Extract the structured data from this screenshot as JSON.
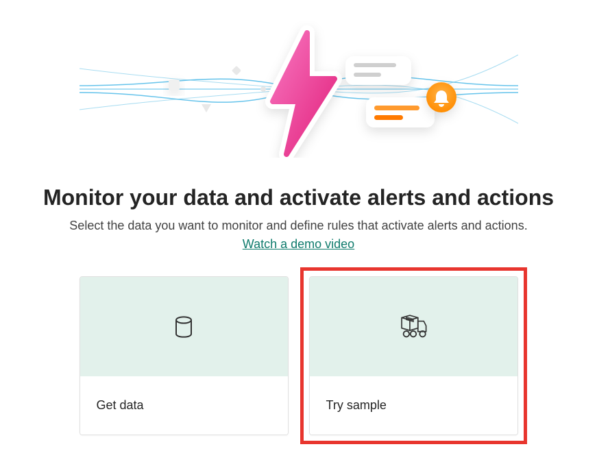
{
  "hero": {
    "heading": "Monitor your data and activate alerts and actions",
    "subtext": "Select the data you want to monitor and define rules that activate alerts and actions.",
    "demo_link_label": "Watch a demo video"
  },
  "cards": {
    "get_data": {
      "label": "Get data",
      "icon": "database-icon"
    },
    "try_sample": {
      "label": "Try sample",
      "icon": "truck-icon",
      "highlighted": true
    }
  },
  "colors": {
    "accent_link": "#0f7b6c",
    "card_top_bg": "#e2f1eb",
    "highlight_border": "#e8352e",
    "bolt_gradient_start": "#f54ea2",
    "bolt_gradient_end": "#e1207b",
    "bell_gradient_start": "#ffb347",
    "bell_gradient_end": "#ff8c00"
  }
}
